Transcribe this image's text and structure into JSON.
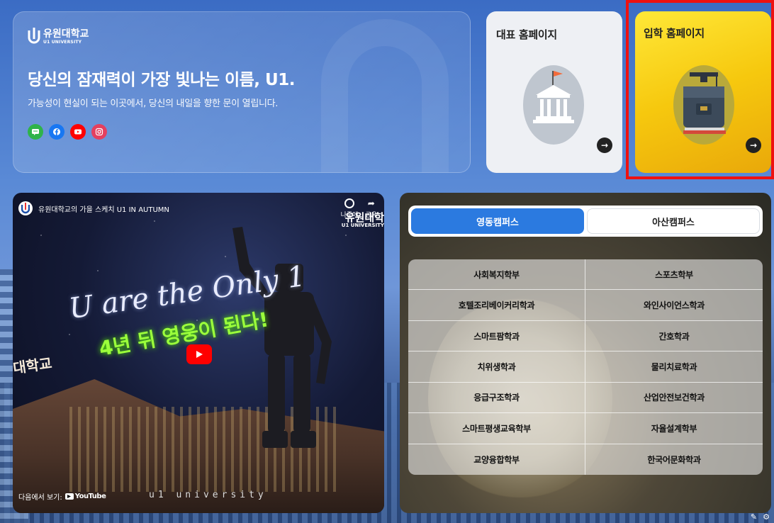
{
  "hero": {
    "logo_ko": "유원대학교",
    "logo_en": "U1 UNIVERSITY",
    "title": "당신의 잠재력이 가장 빛나는 이름, U1.",
    "subtitle": "가능성이 현실이 되는 이곳에서, 당신의 내일을 향한 문이 열립니다.",
    "socials": [
      {
        "name": "talk-icon",
        "color": "#2fb34a"
      },
      {
        "name": "facebook-icon",
        "color": "#1877f2"
      },
      {
        "name": "youtube-icon",
        "color": "#ff0000"
      },
      {
        "name": "instagram-icon",
        "color": "#e4405f"
      }
    ]
  },
  "cards": {
    "main": {
      "title": "대표 홈페이지",
      "icon": "building-icon",
      "arrow": "→"
    },
    "admission": {
      "title": "입학 홈페이지",
      "icon": "book-graduation-icon",
      "arrow": "→"
    }
  },
  "video": {
    "title": "유원대학교의 가을 스케치 U1 IN AUTUMN",
    "watch_later": "나중에",
    "share": "공유",
    "brand": "유원대학",
    "brand_sub": "U1 UNIVERSITY",
    "slogan": "U are the Only 1",
    "neon_text": "4년 뒤 영웅이 된다!",
    "building_text": "대학교",
    "watermark": "u1 university",
    "watch_on": "다음에서 보기:",
    "youtube_label": "YouTube"
  },
  "campus": {
    "tabs": [
      {
        "label": "영동캠퍼스",
        "active": true
      },
      {
        "label": "아산캠퍼스",
        "active": false
      }
    ],
    "departments": [
      "사회복지학부",
      "스포츠학부",
      "호텔조리베이커리학과",
      "와인사이언스학과",
      "스마트팜학과",
      "간호학과",
      "치위생학과",
      "물리치료학과",
      "응급구조학과",
      "산업안전보건학과",
      "스마트평생교육학부",
      "자율설계학부",
      "교양융합학부",
      "한국어문화학과"
    ]
  },
  "colors": {
    "accent": "#2b7ae0",
    "admission_yellow": "#ffe838",
    "highlight": "#ee1111"
  }
}
